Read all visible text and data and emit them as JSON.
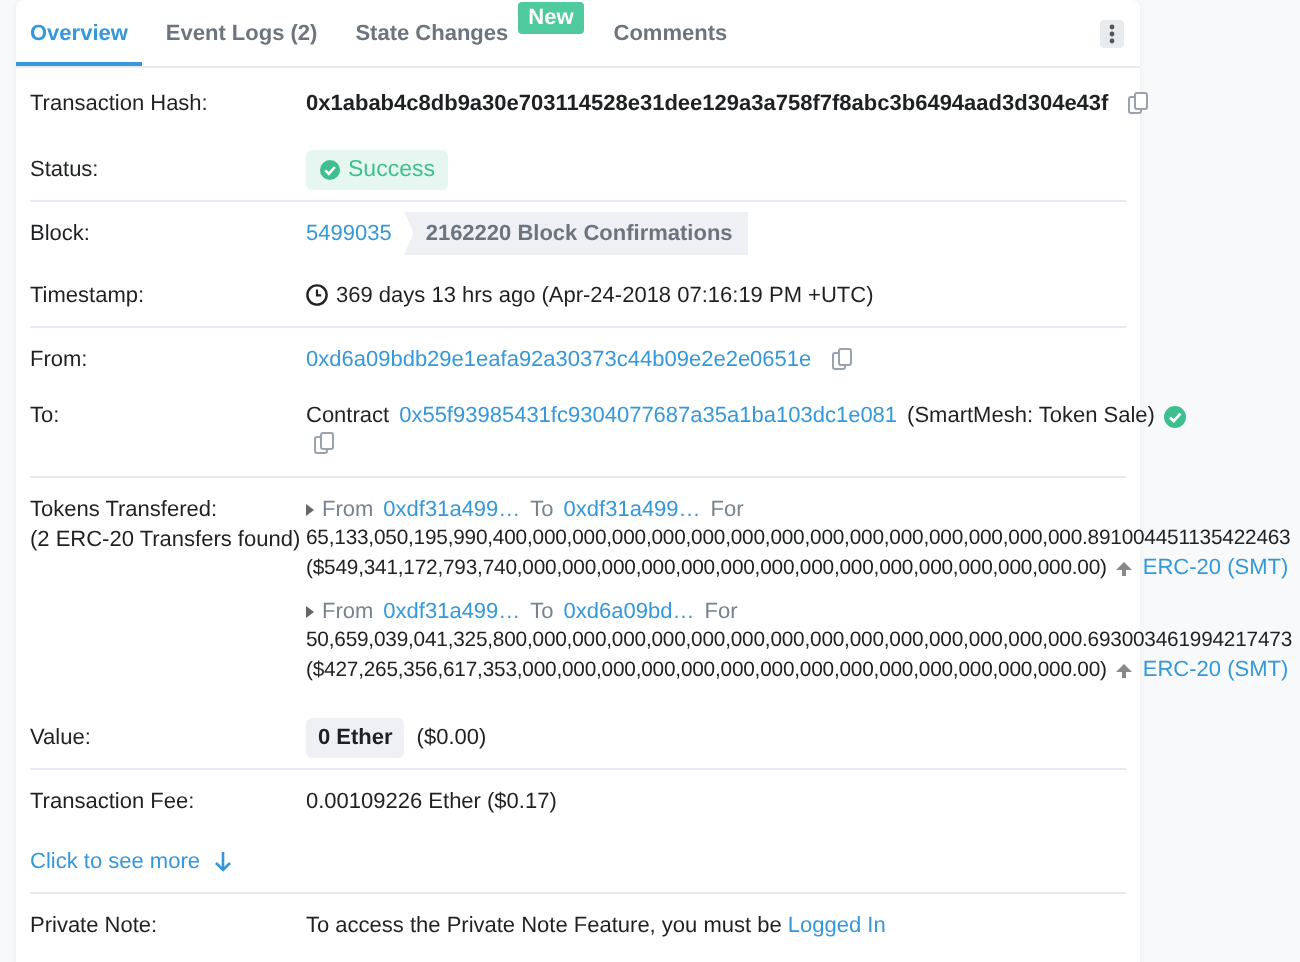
{
  "tabs": [
    {
      "label": "Overview",
      "selected": true
    },
    {
      "label": "Event Logs (2)",
      "selected": false
    },
    {
      "label": "State Changes",
      "selected": false,
      "badge": "New"
    },
    {
      "label": "Comments",
      "selected": false
    }
  ],
  "hash": {
    "label": "Transaction Hash:",
    "value": "0x1abab4c8db9a30e703114528e31dee129a3a758f7f8abc3b6494aad3d304e43f"
  },
  "status": {
    "label": "Status:",
    "value": "Success"
  },
  "block": {
    "label": "Block:",
    "number": "5499035",
    "confirmations": "2162220 Block Confirmations"
  },
  "timestamp": {
    "label": "Timestamp:",
    "value": "369 days 13 hrs ago (Apr-24-2018 07:16:19 PM +UTC)"
  },
  "from": {
    "label": "From:",
    "address": "0xd6a09bdb29e1eafa92a30373c44b09e2e2e0651e"
  },
  "to": {
    "label": "To:",
    "prefix": "Contract",
    "address": "0x55f93985431fc9304077687a35a1ba103dc1e081",
    "name": "(SmartMesh: Token Sale)",
    "verified": true
  },
  "tokens": {
    "label": "Tokens Transfered:",
    "sublabel": "(2 ERC-20 Transfers found)",
    "transfers": [
      {
        "from_label": "From",
        "from": "0xdf31a499…",
        "to_label": "To",
        "to": "0xdf31a499…",
        "for_label": "For",
        "amount": "65,133,050,195,990,400,000,000,000,000,000,000,000,000,000,000,000,000,000,000.891004451135422463",
        "usd": "($549,341,172,793,740,000,000,000,000,000,000,000,000,000,000,000,000,000,000.00)",
        "token": "ERC-20 (SMT)"
      },
      {
        "from_label": "From",
        "from": "0xdf31a499…",
        "to_label": "To",
        "to": "0xd6a09bd…",
        "for_label": "For",
        "amount": "50,659,039,041,325,800,000,000,000,000,000,000,000,000,000,000,000,000,000,000.693003461994217473",
        "usd": "($427,265,356,617,353,000,000,000,000,000,000,000,000,000,000,000,000,000,000.00)",
        "token": "ERC-20 (SMT)"
      }
    ]
  },
  "value": {
    "label": "Value:",
    "amount": "0 Ether",
    "usd": "($0.00)"
  },
  "fee": {
    "label": "Transaction Fee:",
    "value": "0.00109226 Ether ($0.17)"
  },
  "see_more": {
    "label": "Click to see more"
  },
  "private_note": {
    "label": "Private Note:",
    "text": "To access the Private Note Feature, you must be",
    "link": "Logged In"
  }
}
